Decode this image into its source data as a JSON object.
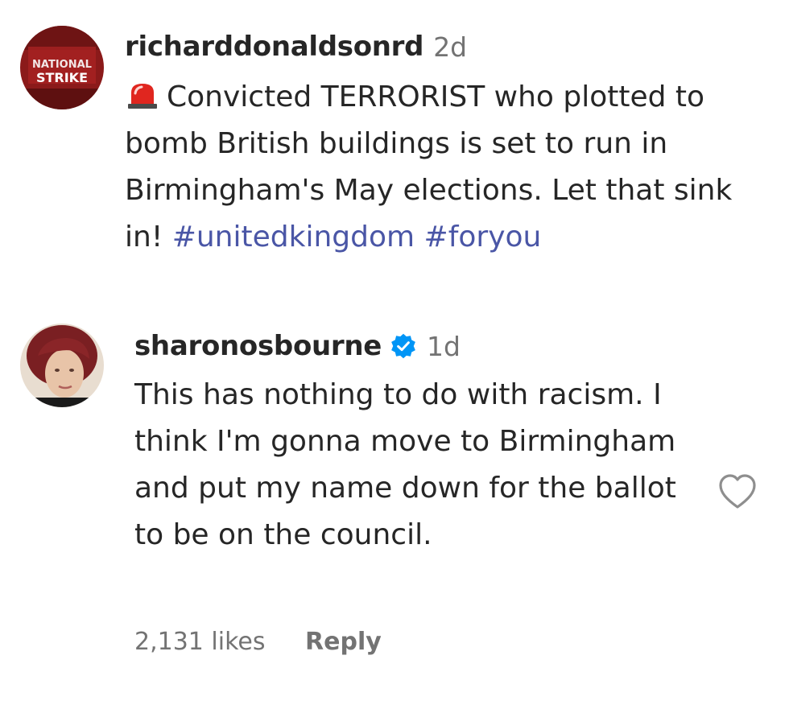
{
  "comments": [
    {
      "username": "richarddonaldsonrd",
      "time": "2d",
      "siren_icon": "siren-icon",
      "text_before": "Convicted TERRORIST who plotted to bomb British buildings is set to run in Birmingham's May elections. Let that sink in!",
      "hashtags": [
        "#unitedkingdom",
        "#foryou"
      ],
      "avatar_text_top": "NATIONAL",
      "avatar_text_bottom": "STRIKE",
      "avatar_color": "#8b1a1a"
    },
    {
      "username": "sharonosbourne",
      "verified": true,
      "verified_color": "#0095f6",
      "time": "1d",
      "text": "This has nothing to do with racism. I think I'm gonna move to Birmingham and put my name down for the ballot to be on the council.",
      "likes": "2,131 likes",
      "reply": "Reply",
      "hair_color": "#7a1f22"
    }
  ]
}
